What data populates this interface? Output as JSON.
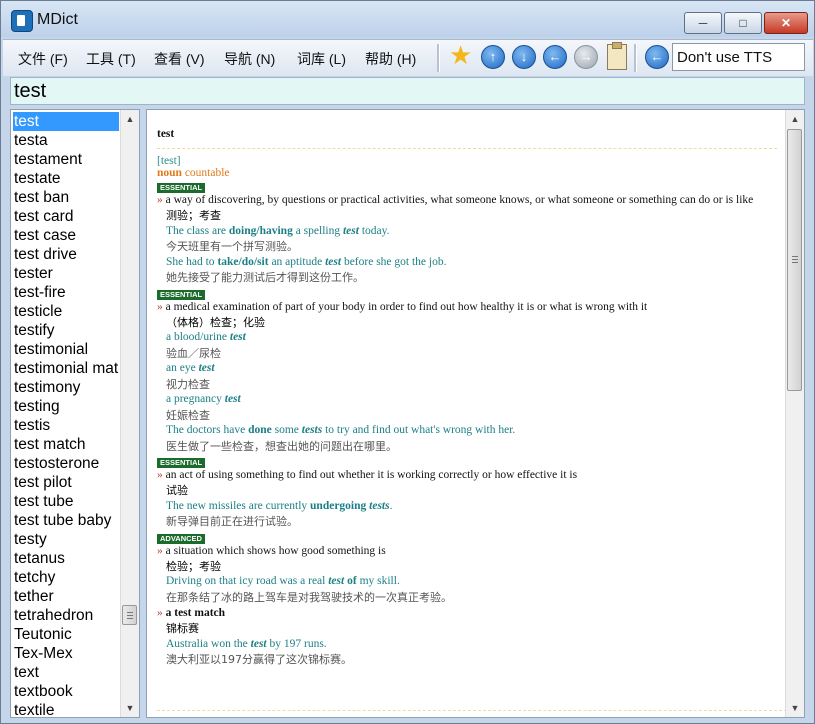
{
  "window": {
    "title": "MDict",
    "app_icon": "mdict-app-icon",
    "minimize_icon": "minimize-icon",
    "maximize_icon": "maximize-icon",
    "close_icon": "close-icon"
  },
  "menu": [
    {
      "id": "file",
      "label": "文件 (F)"
    },
    {
      "id": "tools",
      "label": "工具 (T)"
    },
    {
      "id": "view",
      "label": "查看 (V)"
    },
    {
      "id": "navigate",
      "label": "导航 (N)"
    },
    {
      "id": "library",
      "label": "词库 (L)"
    },
    {
      "id": "help",
      "label": "帮助 (H)"
    }
  ],
  "toolbar": {
    "icons": [
      "star-icon",
      "arrow-up-icon",
      "arrow-down-icon",
      "arrow-left-icon",
      "arrow-right-icon",
      "clipboard-icon",
      "speaker-back-icon"
    ],
    "tts_option": "Don't use TTS"
  },
  "search": {
    "value": "test"
  },
  "wordlist": {
    "selected": "test",
    "items": [
      "test",
      "testa",
      "testament",
      "testate",
      "test ban",
      "test card",
      "test case",
      "test drive",
      "tester",
      "test-fire",
      "testicle",
      "testify",
      "testimonial",
      "testimonial match",
      "testimony",
      "testing",
      "testis",
      "test match",
      "testosterone",
      "test pilot",
      "test tube",
      "test tube baby",
      "testy",
      "tetanus",
      "tetchy",
      "tether",
      "tetrahedron",
      "Teutonic",
      "Tex-Mex",
      "text",
      "textbook",
      "textile"
    ]
  },
  "entry": {
    "headword": "test",
    "pron": "[test]",
    "pos": "noun",
    "grammar": "countable",
    "senses": [
      {
        "level": "ESSENTIAL",
        "definition": "a way of discovering, by questions or practical activities, what someone knows, or what someone or something can do or is like",
        "zh": "测验；考查",
        "examples": [
          {
            "en_parts": [
              "The class are ",
              "doing/having",
              " a spelling ",
              "test",
              " today."
            ],
            "zh": "今天班里有一个拼写测验。"
          },
          {
            "en_parts": [
              "She had to ",
              "take/do/sit",
              " an aptitude ",
              "test",
              " before she got the job."
            ],
            "zh": "她先接受了能力测试后才得到这份工作。"
          }
        ]
      },
      {
        "level": "ESSENTIAL",
        "definition": "a medical examination of part of your body in order to find out how healthy it is or what is wrong with it",
        "zh": "（体格）检查；化验",
        "examples": [
          {
            "en_parts": [
              "a blood/urine ",
              "test"
            ],
            "zh": "验血／尿检"
          },
          {
            "en_parts": [
              "an eye ",
              "test"
            ],
            "zh": "视力检查"
          },
          {
            "en_parts": [
              "a pregnancy ",
              "test"
            ],
            "zh": "妊娠检查"
          },
          {
            "en_parts": [
              "The doctors have ",
              "done",
              " some ",
              "tests",
              " to try and find out what's wrong with her."
            ],
            "zh": "医生做了一些检查，想查出她的问题出在哪里。"
          }
        ]
      },
      {
        "level": "ESSENTIAL",
        "definition": "an act of using something to find out whether it is working correctly or how effective it is",
        "zh": "试验",
        "examples": [
          {
            "en_parts": [
              "The new missiles are currently ",
              "undergoing",
              " ",
              "tests",
              "."
            ],
            "zh": "新导弹目前正在进行试验。"
          }
        ]
      },
      {
        "level": "ADVANCED",
        "definition": "a situation which shows how good something is",
        "zh": "检验；考验",
        "examples": [
          {
            "en_parts": [
              "Driving on that icy road was a real ",
              "test",
              " ",
              "of",
              " my skill."
            ],
            "zh": "在那条结了冰的路上驾车是对我驾驶技术的一次真正考验。"
          }
        ]
      },
      {
        "level": "",
        "definition": "a test match",
        "zh": "锦标赛",
        "examples": [
          {
            "en_parts": [
              "Australia won the ",
              "test",
              " by 197 runs."
            ],
            "zh": "澳大利亚以197分赢得了这次锦标赛。"
          }
        ]
      }
    ]
  }
}
